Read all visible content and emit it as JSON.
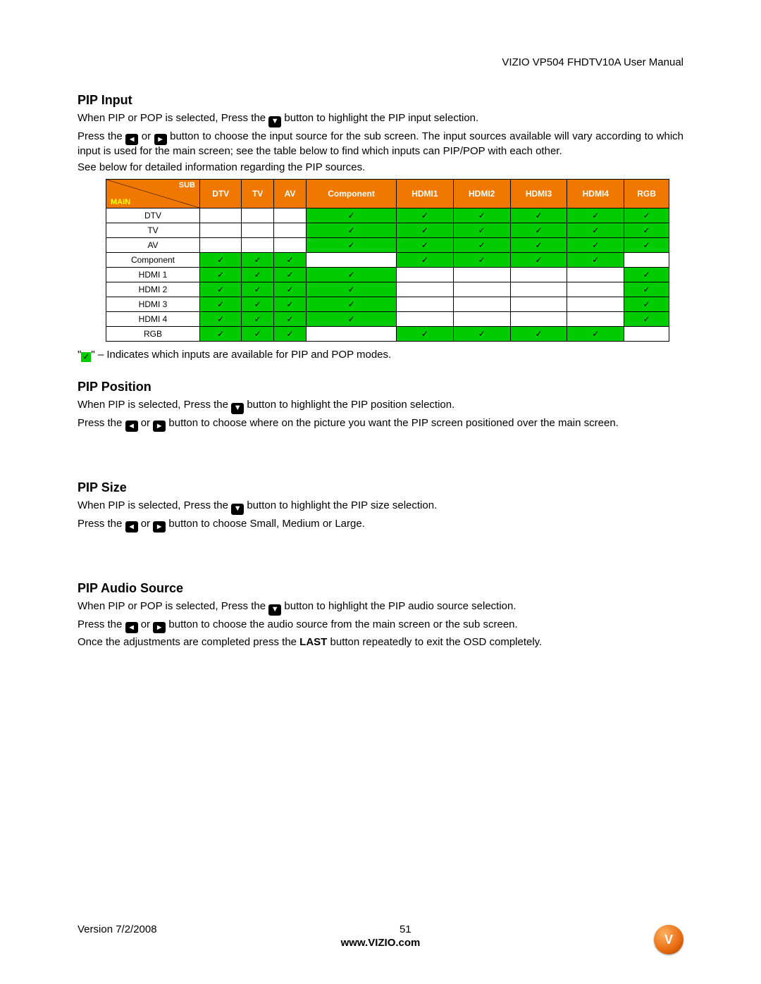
{
  "header": {
    "manual_title": "VIZIO VP504 FHDTV10A User Manual"
  },
  "sections": {
    "pip_input": {
      "title": "PIP Input",
      "p1a": "When PIP or POP is selected, Press the ",
      "p1b": " button to highlight the PIP input selection.",
      "p2a": "Press the ",
      "p2b": " or ",
      "p2c": " button to choose the input source for the sub screen. The input sources available will vary according to which input is used for the main screen; see the table below to find which inputs can PIP/POP with each other.",
      "p3": "See below for detailed information regarding the PIP sources."
    },
    "pip_position": {
      "title": "PIP Position",
      "p1a": "When PIP is selected, Press the ",
      "p1b": " button to highlight the PIP position selection.",
      "p2a": "Press the ",
      "p2b": " or ",
      "p2c": " button to choose where on the picture you want the PIP screen positioned over the main screen."
    },
    "pip_size": {
      "title": "PIP Size",
      "p1a": "When PIP is selected, Press the ",
      "p1b": " button to highlight the PIP size selection.",
      "p2a": "Press the ",
      "p2b": " or ",
      "p2c": " button to choose Small, Medium or Large."
    },
    "pip_audio": {
      "title": "PIP Audio Source",
      "p1a": "When PIP or POP is selected, Press the ",
      "p1b": " button to highlight the PIP audio source selection.",
      "p2a": "Press the ",
      "p2b": " or ",
      "p2c": " button to choose the audio source from the main screen or the sub screen.",
      "p3a": "Once the adjustments are completed press the ",
      "p3b": "LAST",
      "p3c": " button repeatedly to exit the OSD completely."
    }
  },
  "icons": {
    "down": "▼",
    "left": "◄",
    "right": "►",
    "check": "✓"
  },
  "table": {
    "corner": {
      "sub": "SUB",
      "main": "MAIN"
    },
    "columns": [
      "DTV",
      "TV",
      "AV",
      "Component",
      "HDMI1",
      "HDMI2",
      "HDMI3",
      "HDMI4",
      "RGB"
    ],
    "rows": [
      "DTV",
      "TV",
      "AV",
      "Component",
      "HDMI 1",
      "HDMI 2",
      "HDMI 3",
      "HDMI 4",
      "RGB"
    ]
  },
  "legend": {
    "prefix": "\"",
    "mid": "\" – Indicates which inputs are available for PIP and POP modes."
  },
  "footer": {
    "version": "Version 7/2/2008",
    "page": "51",
    "url": "www.VIZIO.com",
    "logo_letter": "V"
  },
  "chart_data": {
    "type": "table",
    "title": "PIP/POP compatible input source matrix (main vs sub)",
    "columns_sub": [
      "DTV",
      "TV",
      "AV",
      "Component",
      "HDMI1",
      "HDMI2",
      "HDMI3",
      "HDMI4",
      "RGB"
    ],
    "rows_main": [
      "DTV",
      "TV",
      "AV",
      "Component",
      "HDMI 1",
      "HDMI 2",
      "HDMI 3",
      "HDMI 4",
      "RGB"
    ],
    "legend": "1 = compatible (green check), 0 = not available (blank)",
    "matrix": [
      [
        0,
        0,
        0,
        1,
        1,
        1,
        1,
        1,
        1
      ],
      [
        0,
        0,
        0,
        1,
        1,
        1,
        1,
        1,
        1
      ],
      [
        0,
        0,
        0,
        1,
        1,
        1,
        1,
        1,
        1
      ],
      [
        1,
        1,
        1,
        0,
        1,
        1,
        1,
        1,
        0
      ],
      [
        1,
        1,
        1,
        1,
        0,
        0,
        0,
        0,
        1
      ],
      [
        1,
        1,
        1,
        1,
        0,
        0,
        0,
        0,
        1
      ],
      [
        1,
        1,
        1,
        1,
        0,
        0,
        0,
        0,
        1
      ],
      [
        1,
        1,
        1,
        1,
        0,
        0,
        0,
        0,
        1
      ],
      [
        1,
        1,
        1,
        0,
        1,
        1,
        1,
        1,
        0
      ]
    ]
  }
}
